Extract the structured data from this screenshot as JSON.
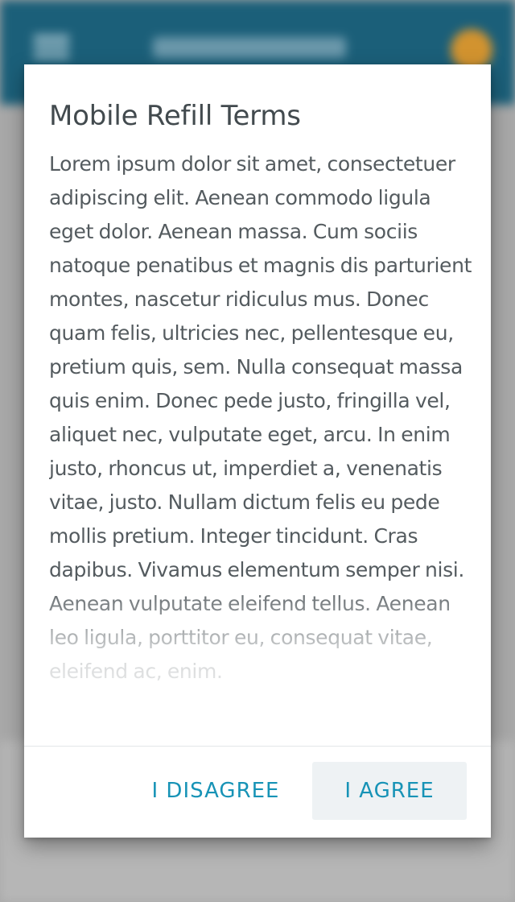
{
  "dialog": {
    "title": "Mobile Refill Terms",
    "body": "Lorem ipsum dolor sit amet, consectetuer adipiscing elit. Aenean commodo ligula eget dolor. Aenean massa. Cum sociis natoque penatibus et magnis dis parturient montes, nascetur ridiculus mus. Donec quam felis, ultricies nec, pellentesque eu, pretium quis, sem. Nulla consequat massa quis enim. Donec pede justo, fringilla vel, aliquet nec, vulputate eget, arcu. In enim justo, rhoncus ut, imperdiet a, venenatis vitae, justo. Nullam dictum felis eu pede mollis pretium. Integer tincidunt. Cras dapibus. Vivamus elementum semper nisi. Aenean vulputate eleifend tellus. Aenean leo ligula, porttitor eu, consequat vitae, eleifend ac, enim.",
    "disagree_label": "I DISAGREE",
    "agree_label": "I AGREE"
  },
  "colors": {
    "accent": "#1793b6",
    "app_bar": "#1b5f79",
    "title_text": "#424a4e",
    "body_text": "#545b5f",
    "agree_button_bg": "#eef2f4"
  },
  "icons": {
    "background_menu": "menu-icon",
    "background_avatar": "avatar"
  }
}
